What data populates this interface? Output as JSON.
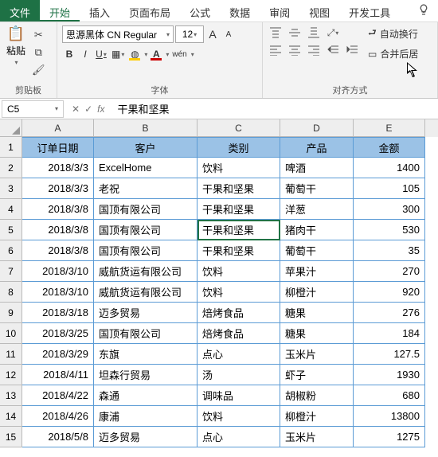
{
  "menu": {
    "file": "文件",
    "tabs": [
      "开始",
      "插入",
      "页面布局",
      "公式",
      "数据",
      "审阅",
      "视图",
      "开发工具"
    ]
  },
  "ribbon": {
    "clipboard": {
      "paste": "粘贴",
      "label": "剪贴板"
    },
    "font": {
      "name": "思源黑体 CN Regular",
      "size": "12",
      "bold": "B",
      "italic": "I",
      "underline": "U",
      "wen": "wén",
      "label": "字体",
      "bigA": "A",
      "smallA": "A"
    },
    "align": {
      "wrap": "自动换行",
      "merge": "合并后居",
      "label": "对齐方式"
    }
  },
  "nameBox": "C5",
  "formula": "干果和坚果",
  "fx": "fx",
  "columns": [
    "A",
    "B",
    "C",
    "D",
    "E"
  ],
  "headerRow": [
    "订单日期",
    "客户",
    "类别",
    "产品",
    "金额"
  ],
  "rows": [
    {
      "n": 1,
      "cells": [
        "订单日期",
        "客户",
        "类别",
        "产品",
        "金额"
      ],
      "isHeader": true
    },
    {
      "n": 2,
      "cells": [
        "2018/3/3",
        "ExcelHome",
        "饮料",
        "啤酒",
        "1400"
      ]
    },
    {
      "n": 3,
      "cells": [
        "2018/3/3",
        "老祝",
        "干果和坚果",
        "葡萄干",
        "105"
      ]
    },
    {
      "n": 4,
      "cells": [
        "2018/3/8",
        "国顶有限公司",
        "干果和坚果",
        "洋葱",
        "300"
      ]
    },
    {
      "n": 5,
      "cells": [
        "2018/3/8",
        "国顶有限公司",
        "干果和坚果",
        "猪肉干",
        "530"
      ]
    },
    {
      "n": 6,
      "cells": [
        "2018/3/8",
        "国顶有限公司",
        "干果和坚果",
        "葡萄干",
        "35"
      ]
    },
    {
      "n": 7,
      "cells": [
        "2018/3/10",
        "威航货运有限公司",
        "饮料",
        "苹果汁",
        "270"
      ]
    },
    {
      "n": 8,
      "cells": [
        "2018/3/10",
        "威航货运有限公司",
        "饮料",
        "柳橙汁",
        "920"
      ]
    },
    {
      "n": 9,
      "cells": [
        "2018/3/18",
        "迈多贸易",
        "焙烤食品",
        "糖果",
        "276"
      ]
    },
    {
      "n": 10,
      "cells": [
        "2018/3/25",
        "国顶有限公司",
        "焙烤食品",
        "糖果",
        "184"
      ]
    },
    {
      "n": 11,
      "cells": [
        "2018/3/29",
        "东旗",
        "点心",
        "玉米片",
        "127.5"
      ]
    },
    {
      "n": 12,
      "cells": [
        "2018/4/11",
        "坦森行贸易",
        "汤",
        "虾子",
        "1930"
      ]
    },
    {
      "n": 13,
      "cells": [
        "2018/4/22",
        "森通",
        "调味品",
        "胡椒粉",
        "680"
      ]
    },
    {
      "n": 14,
      "cells": [
        "2018/4/26",
        "康浦",
        "饮料",
        "柳橙汁",
        "13800"
      ]
    },
    {
      "n": 15,
      "cells": [
        "2018/5/8",
        "迈多贸易",
        "点心",
        "玉米片",
        "1275"
      ]
    }
  ],
  "selectedCell": "C5",
  "chart_data": {
    "type": "table",
    "title": "",
    "columns": [
      "订单日期",
      "客户",
      "类别",
      "产品",
      "金额"
    ],
    "data": [
      [
        "2018/3/3",
        "ExcelHome",
        "饮料",
        "啤酒",
        1400
      ],
      [
        "2018/3/3",
        "老祝",
        "干果和坚果",
        "葡萄干",
        105
      ],
      [
        "2018/3/8",
        "国顶有限公司",
        "干果和坚果",
        "洋葱",
        300
      ],
      [
        "2018/3/8",
        "国顶有限公司",
        "干果和坚果",
        "猪肉干",
        530
      ],
      [
        "2018/3/8",
        "国顶有限公司",
        "干果和坚果",
        "葡萄干",
        35
      ],
      [
        "2018/3/10",
        "威航货运有限公司",
        "饮料",
        "苹果汁",
        270
      ],
      [
        "2018/3/10",
        "威航货运有限公司",
        "饮料",
        "柳橙汁",
        920
      ],
      [
        "2018/3/18",
        "迈多贸易",
        "焙烤食品",
        "糖果",
        276
      ],
      [
        "2018/3/25",
        "国顶有限公司",
        "焙烤食品",
        "糖果",
        184
      ],
      [
        "2018/3/29",
        "东旗",
        "点心",
        "玉米片",
        127.5
      ],
      [
        "2018/4/11",
        "坦森行贸易",
        "汤",
        "虾子",
        1930
      ],
      [
        "2018/4/22",
        "森通",
        "调味品",
        "胡椒粉",
        680
      ],
      [
        "2018/4/26",
        "康浦",
        "饮料",
        "柳橙汁",
        13800
      ],
      [
        "2018/5/8",
        "迈多贸易",
        "点心",
        "玉米片",
        1275
      ]
    ]
  }
}
